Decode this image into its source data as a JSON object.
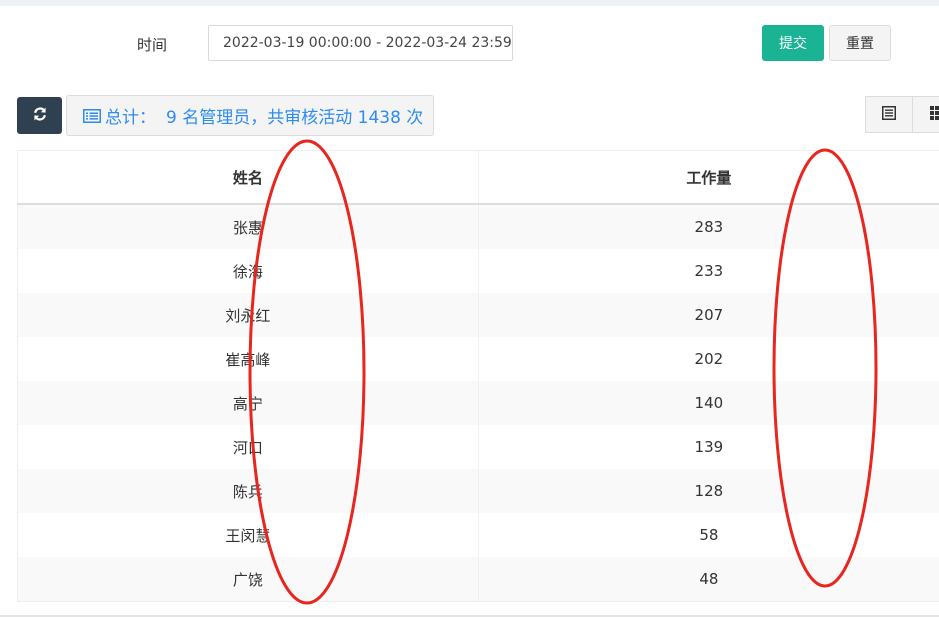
{
  "filter": {
    "time_label": "时间",
    "time_value": "2022-03-19 00:00:00 - 2022-03-24 23:59:",
    "submit_label": "提交",
    "reset_label": "重置"
  },
  "toolbar": {
    "refresh_icon": "refresh-icon",
    "summary_prefix": "总计：",
    "summary_text": "9 名管理员，共审核活动 1438 次",
    "view_buttons": [
      "list-view-icon",
      "grid-view-icon"
    ]
  },
  "table": {
    "headers": [
      "姓名",
      "工作量"
    ],
    "rows": [
      [
        "张惠",
        "283"
      ],
      [
        "徐海",
        "233"
      ],
      [
        "刘永红",
        "207"
      ],
      [
        "崔高峰",
        "202"
      ],
      [
        "高宁",
        "140"
      ],
      [
        "河口",
        "139"
      ],
      [
        "陈兵",
        "128"
      ],
      [
        "王闵慧",
        "58"
      ],
      [
        "广饶",
        "48"
      ]
    ]
  },
  "annotations": {
    "color": "#e8251e",
    "shape": "ellipse"
  },
  "colors": {
    "submit": "#1ab394",
    "refresh": "#2f4050",
    "summary_text": "#2d8cf0"
  }
}
